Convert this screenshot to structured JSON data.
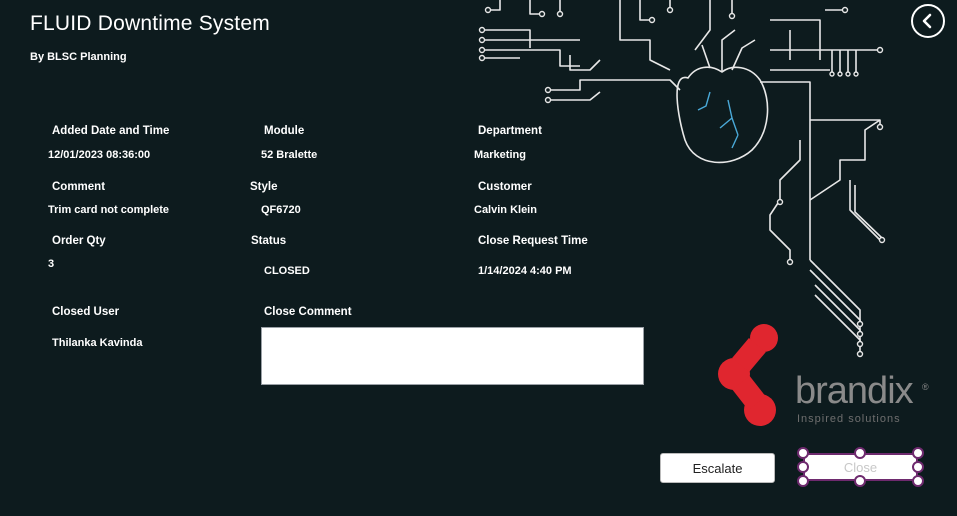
{
  "app": {
    "title": "FLUID Downtime System",
    "subtitle": "By BLSC Planning"
  },
  "fields": {
    "added_date_label": "Added Date and Time",
    "added_date_value": "12/01/2023 08:36:00",
    "module_label": "Module",
    "module_value": "52 Bralette",
    "department_label": "Department",
    "department_value": "Marketing",
    "comment_label": "Comment",
    "comment_value": "Trim card not complete",
    "style_label": "Style",
    "style_value": "QF6720",
    "customer_label": "Customer",
    "customer_value": "Calvin Klein",
    "order_qty_label": "Order Qty",
    "order_qty_value": "3",
    "status_label": "Status",
    "status_value": "CLOSED",
    "close_request_label": "Close Request Time",
    "close_request_value": "1/14/2024 4:40 PM",
    "closed_user_label": "Closed User",
    "closed_user_value": "Thilanka Kavinda",
    "close_comment_label": "Close Comment",
    "close_comment_value": ""
  },
  "buttons": {
    "escalate": "Escalate",
    "close": "Close"
  },
  "logo": {
    "name": "brandix",
    "tagline": "Inspired solutions",
    "mark": "®"
  },
  "icons": {
    "back": "chevron-left-circle-icon"
  },
  "colors": {
    "background": "#0d1b1e",
    "brand_red": "#e0262f",
    "selection": "#6e2a6e"
  }
}
